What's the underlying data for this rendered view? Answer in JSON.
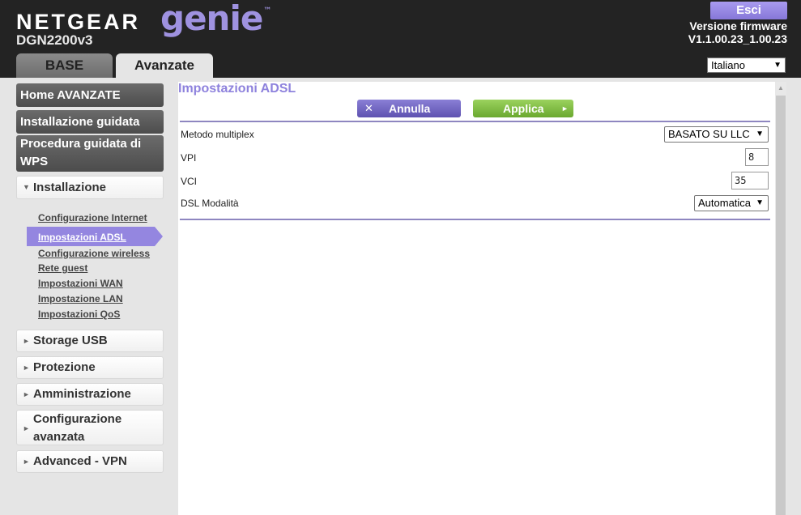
{
  "header": {
    "brand": "NETGEAR",
    "product": "genie",
    "trademark": "™",
    "model": "DGN2200v3",
    "logout_label": "Esci",
    "firmware_label": "Versione firmware",
    "firmware_version": "V1.1.00.23_1.00.23",
    "language": "Italiano"
  },
  "tabs": {
    "base": "BASE",
    "advanced": "Avanzate"
  },
  "sidebar": {
    "home": "Home AVANZATE",
    "wizard": "Installazione guidata",
    "wps_line1": "Procedura guidata di",
    "wps_line2": "WPS",
    "setup": "Installazione",
    "setup_items": [
      "Configurazione Internet",
      "Impostazioni ADSL",
      "Configurazione wireless",
      "Rete guest",
      "Impostazioni WAN",
      "Impostazione LAN",
      "Impostazioni QoS"
    ],
    "usb": "Storage USB",
    "security": "Protezione",
    "admin": "Amministrazione",
    "advanced_line1": "Configurazione",
    "advanced_line2": "avanzata",
    "vpn": "Advanced - VPN"
  },
  "main": {
    "title": "Impostazioni ADSL",
    "cancel_label": "Annulla",
    "apply_label": "Applica",
    "multiplex_label": "Metodo multiplex",
    "multiplex_value": "BASATO SU LLC",
    "vpi_label": "VPI",
    "vpi_value": "8",
    "vci_label": "VCI",
    "vci_value": "35",
    "dsl_mode_label": "DSL Modalità",
    "dsl_mode_value": "Automatica"
  },
  "icons": {
    "dropdown": "▼",
    "collapse": "▼",
    "expand": "►",
    "close": "✕",
    "apply_arrow": "►",
    "scroll_up": "▲"
  },
  "colors": {
    "accent": "#9486e0",
    "header_bg": "#232323",
    "apply": "#7ab83a"
  }
}
